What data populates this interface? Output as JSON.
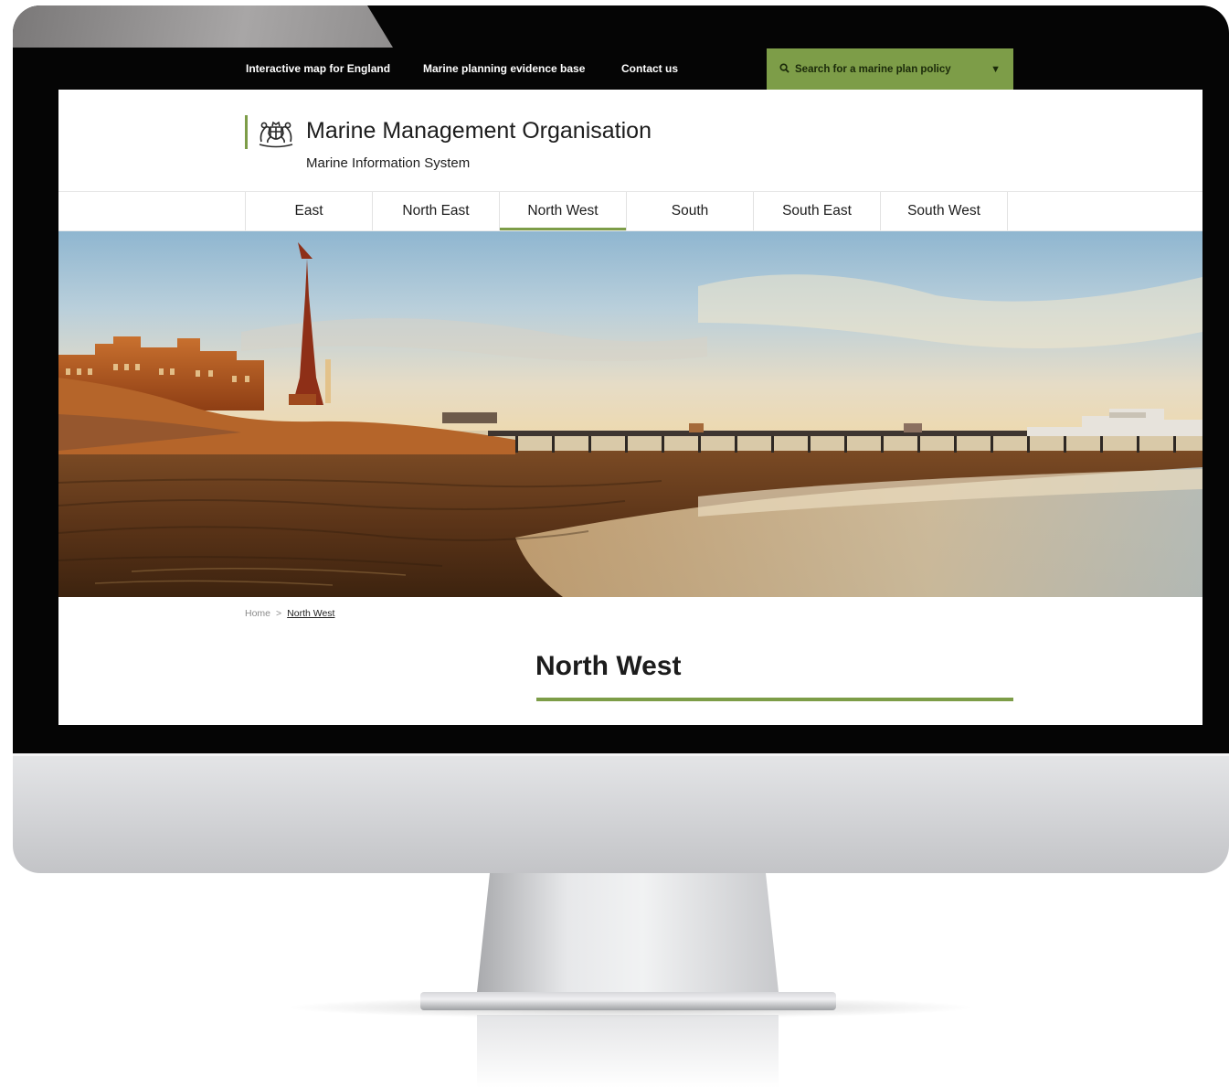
{
  "utility_nav": {
    "links": [
      {
        "label": "Interactive map for England"
      },
      {
        "label": "Marine planning evidence base"
      },
      {
        "label": "Contact us"
      }
    ],
    "search": {
      "label": "Search for a marine plan policy",
      "icon": "search-icon",
      "caret_icon": "caret-down-icon"
    }
  },
  "masthead": {
    "organisation": "Marine Management Organisation",
    "system": "Marine Information System",
    "crest_icon": "royal-crest-icon"
  },
  "region_tabs": [
    {
      "label": "East"
    },
    {
      "label": "North East"
    },
    {
      "label": "North West",
      "active": true
    },
    {
      "label": "South"
    },
    {
      "label": "South East"
    },
    {
      "label": "South West"
    }
  ],
  "breadcrumb": {
    "home": "Home",
    "separator": ">",
    "current": "North West"
  },
  "page": {
    "title": "North West"
  },
  "colors": {
    "accent": "#7d9d48",
    "utility_bar": "#050505",
    "text": "#1c1c1c"
  }
}
